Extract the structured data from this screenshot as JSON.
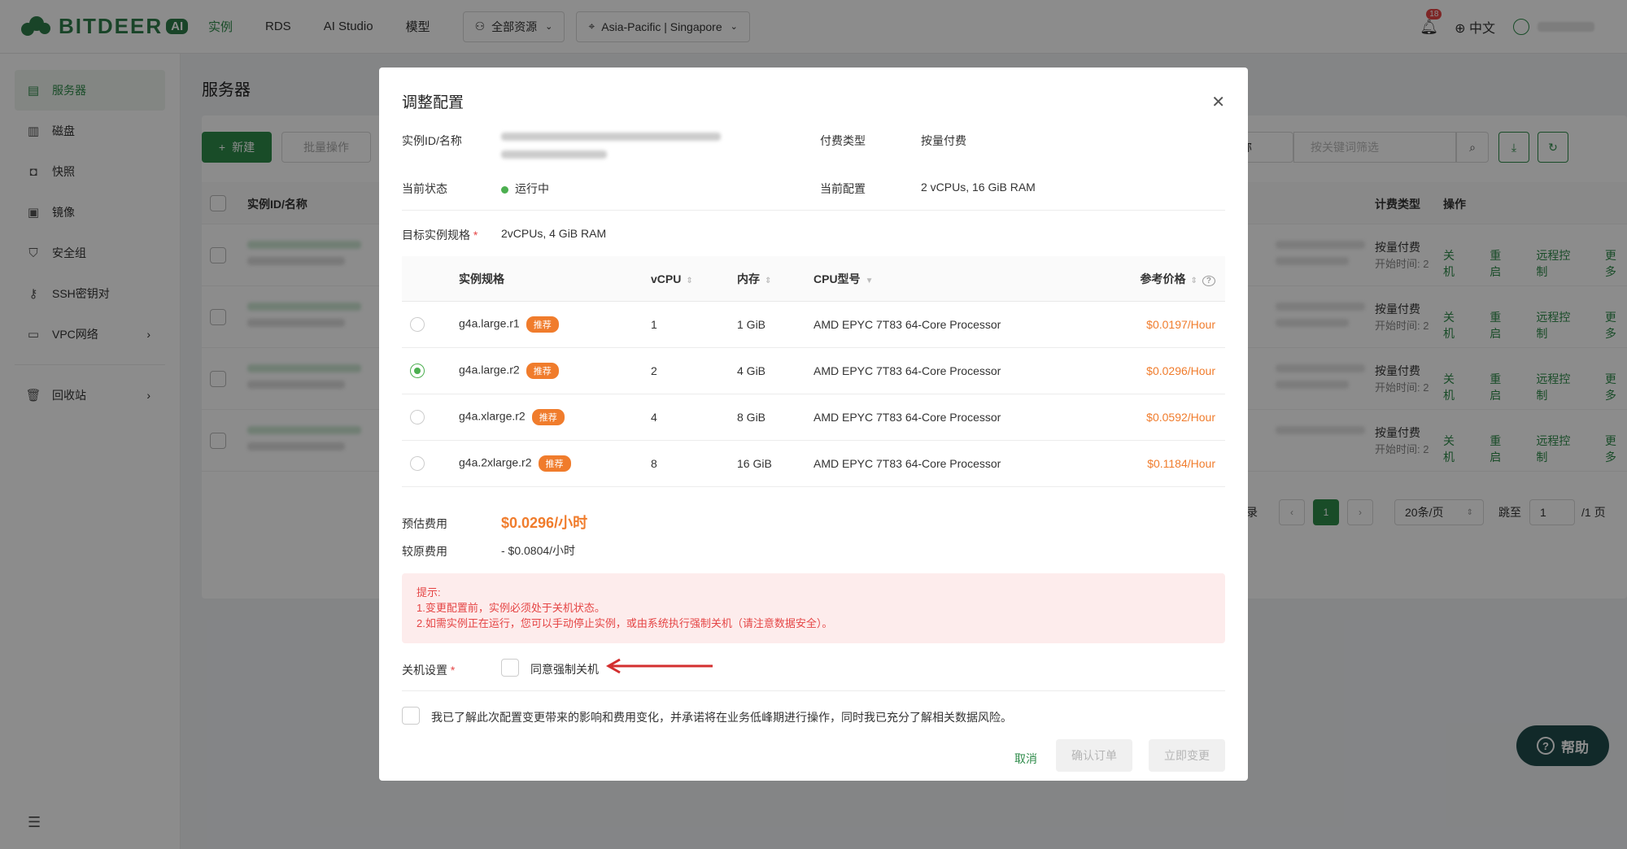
{
  "header": {
    "logo_text": "BITDEER",
    "logo_badge": "AI",
    "nav": [
      "实例",
      "RDS",
      "AI Studio",
      "模型"
    ],
    "resource_select": "全部资源",
    "region_select": "Asia-Pacific | Singapore",
    "notification_count": "18",
    "language": "中文"
  },
  "sidebar": {
    "items": [
      {
        "label": "服务器",
        "icon": "server-icon"
      },
      {
        "label": "磁盘",
        "icon": "disk-icon"
      },
      {
        "label": "快照",
        "icon": "camera-icon"
      },
      {
        "label": "镜像",
        "icon": "image-icon"
      },
      {
        "label": "安全组",
        "icon": "shield-icon"
      },
      {
        "label": "SSH密钥对",
        "icon": "key-icon"
      },
      {
        "label": "VPC网络",
        "icon": "network-icon"
      }
    ],
    "recycle": "回收站"
  },
  "page": {
    "title": "服务器",
    "new_button": "新建",
    "batch_button": "批量操作",
    "search_field": "名称",
    "search_placeholder": "按关键词筛选",
    "columns": {
      "id_name": "实例ID/名称",
      "billing": "计费类型",
      "actions": "操作"
    },
    "rows": [
      {
        "billing": "按量付费",
        "start": "开始时间: 2"
      },
      {
        "billing": "按量付费",
        "start": "开始时间: 2"
      },
      {
        "billing": "按量付费",
        "start": "开始时间: 2"
      },
      {
        "billing": "按量付费",
        "start": "开始时间: 2"
      }
    ],
    "row_actions": [
      "关机",
      "重启",
      "远程控制",
      "更多"
    ],
    "pager": {
      "records_tail": "录",
      "current_page": "1",
      "page_size": "20条/页",
      "jump_label": "跳至",
      "jump_value": "1",
      "total_pages": "/1 页"
    }
  },
  "help_button": "帮助",
  "modal": {
    "title": "调整配置",
    "instance_label": "实例ID/名称",
    "billing_label": "付费类型",
    "billing_value": "按量付费",
    "status_label": "当前状态",
    "status_value": "运行中",
    "current_config_label": "当前配置",
    "current_config_value": "2 vCPUs, 16 GiB RAM",
    "target_label": "目标实例规格",
    "target_value": "2vCPUs, 4 GiB RAM",
    "table": {
      "headers": [
        "实例规格",
        "vCPU",
        "内存",
        "CPU型号",
        "参考价格"
      ],
      "recommend_tag": "推荐",
      "rows": [
        {
          "spec": "g4a.large.r1",
          "vcpu": "1",
          "mem": "1 GiB",
          "cpu": "AMD EPYC 7T83 64-Core Processor",
          "price": "$0.0197/Hour",
          "selected": false
        },
        {
          "spec": "g4a.large.r2",
          "vcpu": "2",
          "mem": "4 GiB",
          "cpu": "AMD EPYC 7T83 64-Core Processor",
          "price": "$0.0296/Hour",
          "selected": true
        },
        {
          "spec": "g4a.xlarge.r2",
          "vcpu": "4",
          "mem": "8 GiB",
          "cpu": "AMD EPYC 7T83 64-Core Processor",
          "price": "$0.0592/Hour",
          "selected": false
        },
        {
          "spec": "g4a.2xlarge.r2",
          "vcpu": "8",
          "mem": "16 GiB",
          "cpu": "AMD EPYC 7T83 64-Core Processor",
          "price": "$0.1184/Hour",
          "selected": false
        }
      ]
    },
    "estimate_label": "预估费用",
    "estimate_value": "$0.0296/小时",
    "saving_label": "较原费用",
    "saving_value": "- $0.0804/小时",
    "tip_title": "提示:",
    "tip_line1": "1.变更配置前，实例必须处于关机状态。",
    "tip_line2": "2.如需实例正在运行，您可以手动停止实例，或由系统执行强制关机（请注意数据安全）。",
    "shutdown_label": "关机设置",
    "shutdown_option": "同意强制关机",
    "ack_text": "我已了解此次配置变更带来的影响和费用变化，并承诺将在业务低峰期进行操作，同时我已充分了解相关数据风险。",
    "cancel": "取消",
    "confirm_order": "确认订单",
    "change_now": "立即变更"
  },
  "colors": {
    "brand": "#2e8b4a",
    "price": "#f07c2c",
    "danger": "#e54545"
  }
}
